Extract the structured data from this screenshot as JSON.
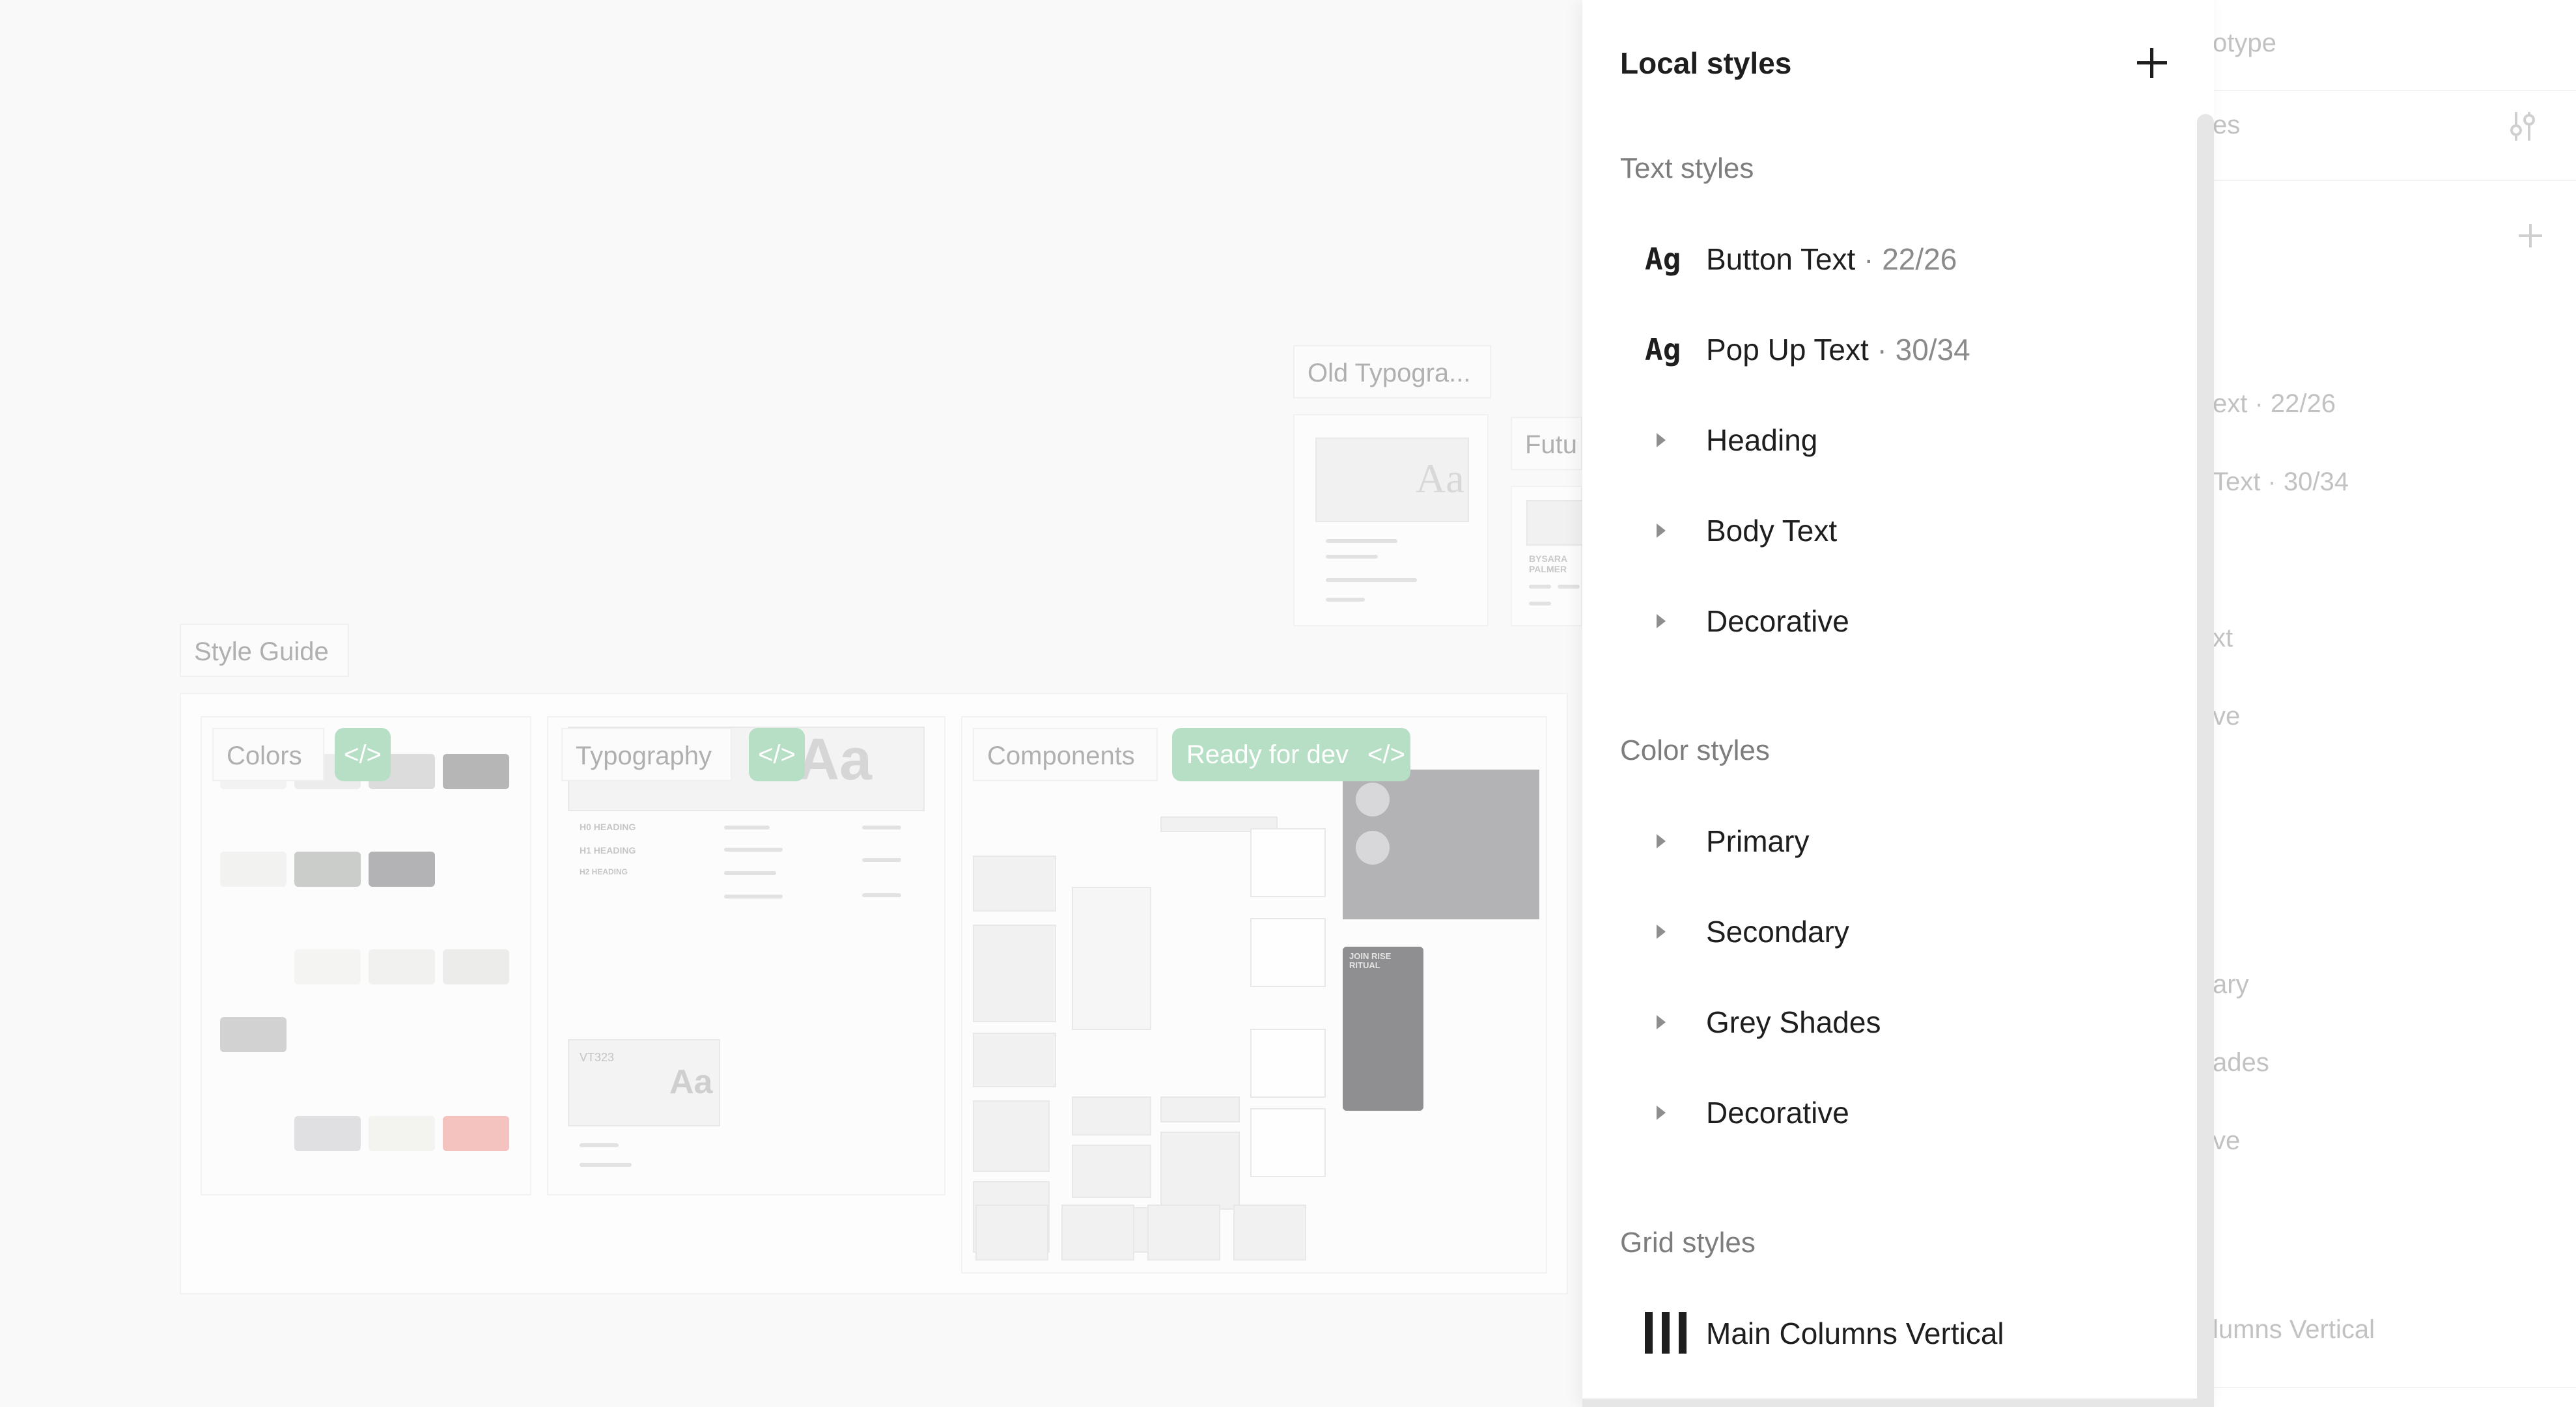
{
  "canvas": {
    "frames": {
      "old_typography": "Old Typogra...",
      "future": "Futu",
      "style_guide": "Style Guide",
      "colors": "Colors",
      "typography": "Typography",
      "components": "Components"
    },
    "ready_for_dev": "Ready for dev",
    "code_badge": "</>",
    "aa_glyph": "Aa",
    "vt323_label": "VT323",
    "h0": "H0 HEADING",
    "h1": "H1 HEADING",
    "h2": "H2 HEADING",
    "join_ritual": "JOIN RISE RITUAL",
    "bysara": "BYSARA PALMER"
  },
  "underlying_panel": {
    "tab_fragment": "otype",
    "fragment_es": "es",
    "fragment_text_1": "ext",
    "fragment_text_1_meta": "· 22/26",
    "fragment_text_2": "Text",
    "fragment_text_2_meta": "· 30/34",
    "fragment_xt": "xt",
    "fragment_ve_1": "ve",
    "fragment_ary": "ary",
    "fragment_ades": "ades",
    "fragment_ve_2": "ve",
    "fragment_columns": "lumns Vertical"
  },
  "popup": {
    "title": "Local styles",
    "text_styles": {
      "header": "Text styles",
      "items": [
        {
          "label": "Button Text",
          "meta": "· 22/26",
          "icon": "text-style-icon"
        },
        {
          "label": "Pop Up Text",
          "meta": "· 30/34",
          "icon": "text-style-icon"
        }
      ],
      "groups": [
        "Heading",
        "Body Text",
        "Decorative"
      ]
    },
    "color_styles": {
      "header": "Color styles",
      "groups": [
        "Primary",
        "Secondary",
        "Grey Shades",
        "Decorative"
      ]
    },
    "grid_styles": {
      "header": "Grid styles",
      "items": [
        {
          "label": "Main Columns Vertical",
          "icon": "grid-columns-icon"
        }
      ]
    }
  },
  "colors": {
    "accent_green": "#b6dfc5",
    "text": "#1e1e1e",
    "muted": "#7d7d7d",
    "swatch_pink": "#f4c3bf",
    "swatch_grey": "#b3b3b6"
  }
}
